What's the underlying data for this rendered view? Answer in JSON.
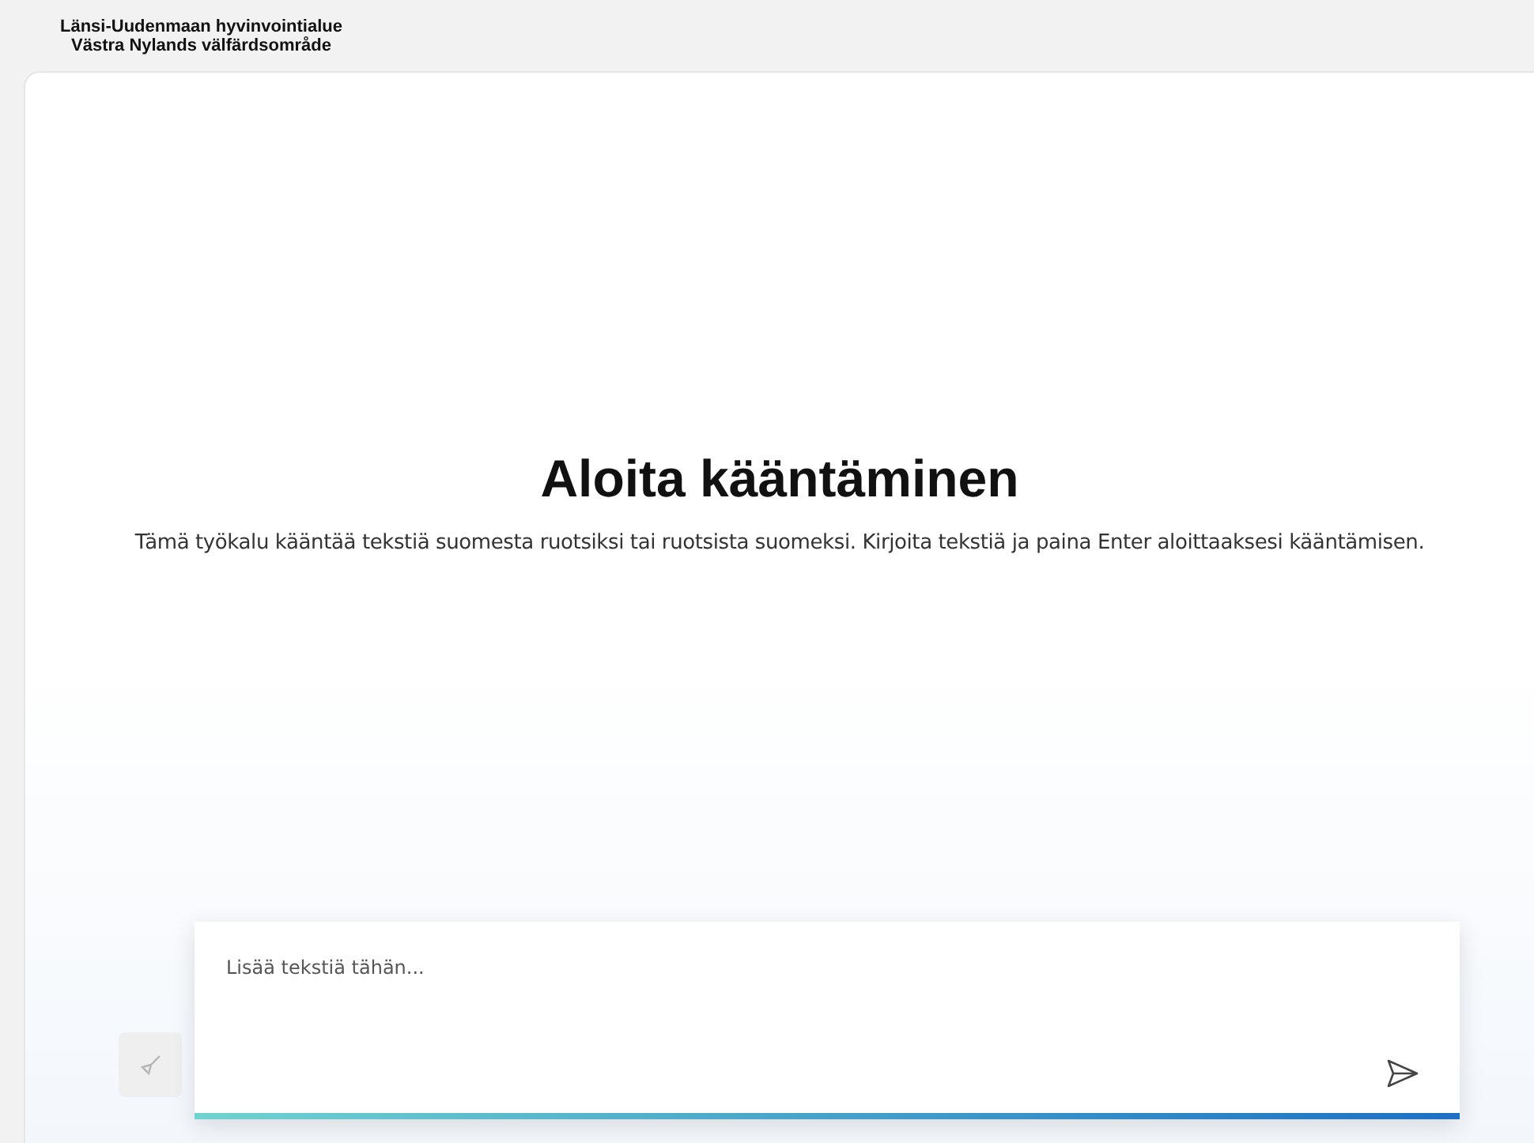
{
  "header": {
    "org_name_fi": "Länsi-Uudenmaan hyvinvointialue",
    "org_name_sv": "Västra Nylands välfärdsområde"
  },
  "intro": {
    "title": "Aloita kääntäminen",
    "description": "Tämä työkalu kääntää tekstiä suomesta ruotsiksi tai ruotsista suomeksi. Kirjoita tekstiä ja paina Enter aloittaaksesi kääntämisen."
  },
  "composer": {
    "placeholder": "Lisää tekstiä tähän...",
    "clear_disabled": true
  }
}
